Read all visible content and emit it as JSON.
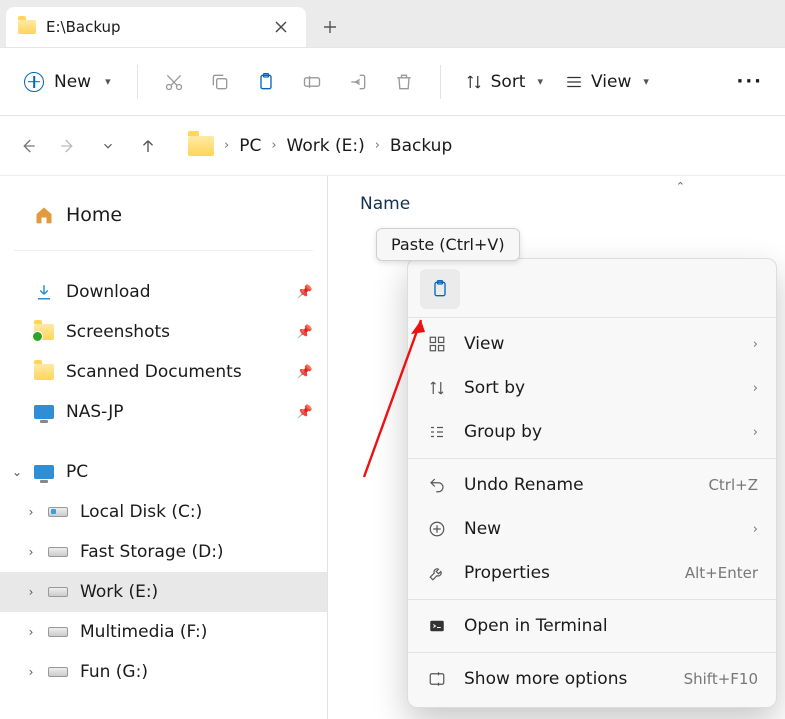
{
  "tab": {
    "title": "E:\\Backup"
  },
  "toolbar": {
    "new_label": "New",
    "sort_label": "Sort",
    "view_label": "View"
  },
  "breadcrumbs": {
    "items": [
      "PC",
      "Work (E:)",
      "Backup"
    ]
  },
  "sidebar": {
    "home": "Home",
    "quick": [
      {
        "label": "Download"
      },
      {
        "label": "Screenshots"
      },
      {
        "label": "Scanned Documents"
      },
      {
        "label": "NAS-JP"
      }
    ],
    "pc_label": "PC",
    "drives": [
      {
        "label": "Local Disk (C:)"
      },
      {
        "label": "Fast Storage (D:)"
      },
      {
        "label": "Work (E:)"
      },
      {
        "label": "Multimedia (F:)"
      },
      {
        "label": "Fun (G:)"
      }
    ]
  },
  "content": {
    "column_name": "Name"
  },
  "tooltip": {
    "text": "Paste (Ctrl+V)"
  },
  "context_menu": {
    "view": "View",
    "sort_by": "Sort by",
    "group_by": "Group by",
    "undo": "Undo Rename",
    "undo_kb": "Ctrl+Z",
    "new": "New",
    "properties": "Properties",
    "properties_kb": "Alt+Enter",
    "terminal": "Open in Terminal",
    "more": "Show more options",
    "more_kb": "Shift+F10"
  }
}
